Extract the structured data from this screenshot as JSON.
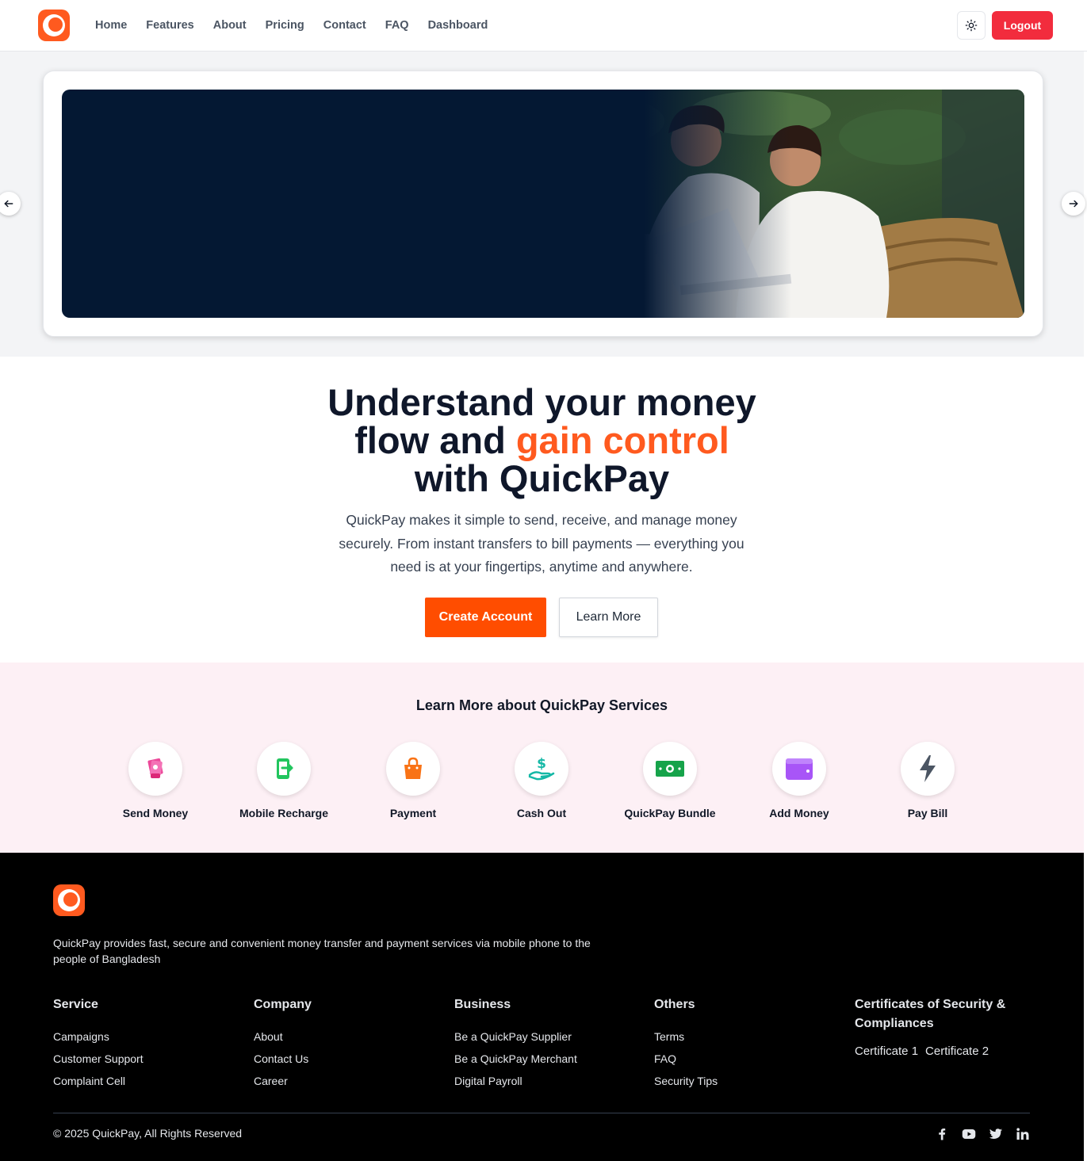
{
  "nav": {
    "links": [
      "Home",
      "Features",
      "About",
      "Pricing",
      "Contact",
      "FAQ",
      "Dashboard"
    ],
    "logout_label": "Logout",
    "theme_icon": "sun-icon"
  },
  "hero": {
    "headline_line1": "Understand your money",
    "headline_line2_pre": "flow and ",
    "headline_accent": "gain control",
    "headline_line3": "with QuickPay",
    "lead": "QuickPay makes it simple to send, receive, and manage money securely. From instant transfers to bill payments — everything you need is at your fingertips, anytime and anywhere.",
    "primary_cta": "Create Account",
    "secondary_cta": "Learn More"
  },
  "services": {
    "title": "Learn More about QuickPay Services",
    "items": [
      {
        "label": "Send Money",
        "icon": "money-hand-icon",
        "color": "#ec4899"
      },
      {
        "label": "Mobile Recharge",
        "icon": "mobile-recharge-icon",
        "color": "#22c55e"
      },
      {
        "label": "Payment",
        "icon": "shopping-bag-icon",
        "color": "#f97316"
      },
      {
        "label": "Cash Out",
        "icon": "cash-out-hand-icon",
        "color": "#14b8a6"
      },
      {
        "label": "QuickPay Bundle",
        "icon": "banknote-icon",
        "color": "#16a34a"
      },
      {
        "label": "Add Money",
        "icon": "wallet-icon",
        "color": "#a855f7"
      },
      {
        "label": "Pay Bill",
        "icon": "lightning-icon",
        "color": "#4b5563"
      }
    ]
  },
  "footer": {
    "description": "QuickPay provides fast, secure and convenient money transfer and payment services via mobile phone to the people of Bangladesh",
    "columns": [
      {
        "title": "Service",
        "links": [
          "Campaigns",
          "Customer Support",
          "Complaint Cell"
        ]
      },
      {
        "title": "Company",
        "links": [
          "About",
          "Contact Us",
          "Career"
        ]
      },
      {
        "title": "Business",
        "links": [
          "Be a QuickPay Supplier",
          "Be a QuickPay Merchant",
          "Digital Payroll"
        ]
      },
      {
        "title": "Others",
        "links": [
          "Terms",
          "FAQ",
          "Security Tips"
        ]
      }
    ],
    "certificates": {
      "title": "Certificates of Security & Compliances",
      "items": [
        "Certificate 1",
        "Certificate 2"
      ]
    },
    "copyright": "© 2025 QuickPay, All Rights Reserved",
    "social": [
      "facebook-icon",
      "youtube-icon",
      "twitter-icon",
      "linkedin-icon"
    ]
  },
  "colors": {
    "brand": "#ff5a1f",
    "logout": "#f22c3d",
    "hero_bg": "#041833",
    "services_bg": "#fdf0f5"
  }
}
